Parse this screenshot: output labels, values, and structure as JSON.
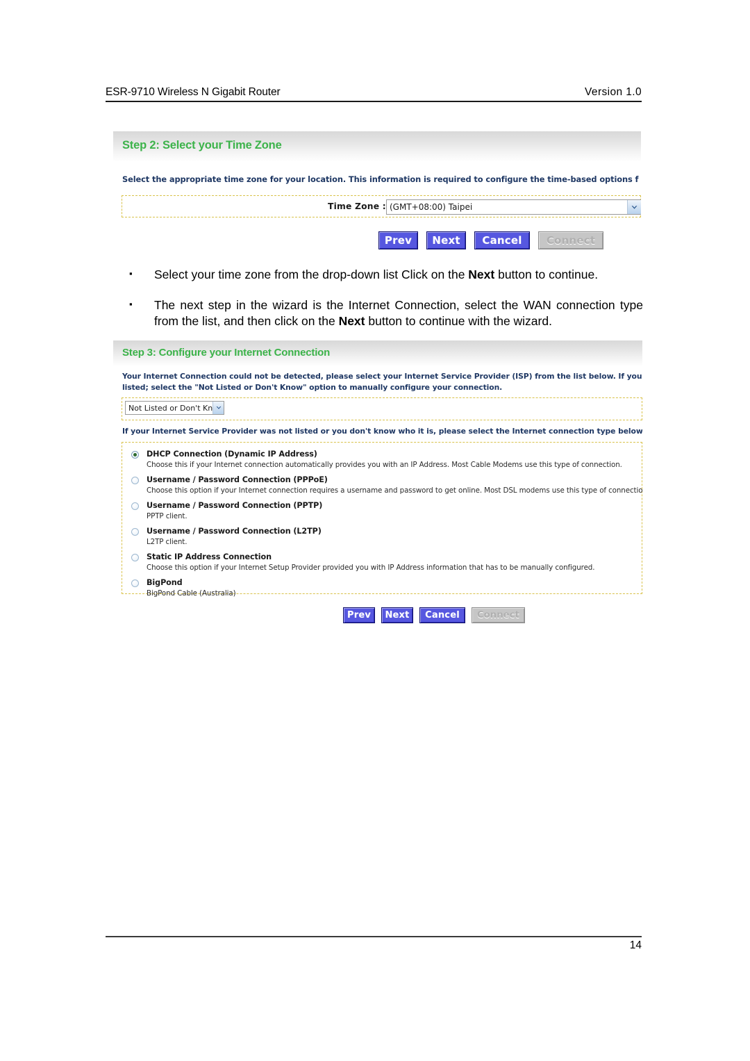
{
  "header": {
    "product": "ESR-9710 Wireless N Gigabit Router",
    "version": "Version 1.0"
  },
  "step2": {
    "title": "Step 2: Select your Time Zone",
    "description": "Select the appropriate time zone for your location. This information is required to configure the time-based options f",
    "timezone_label": "Time Zone :",
    "timezone_value": "(GMT+08:00) Taipei",
    "buttons": {
      "prev": "Prev",
      "next": "Next",
      "cancel": "Cancel",
      "connect": "Connect"
    }
  },
  "bullets": [
    {
      "pre": "Select your time zone from the drop-down list Click on the ",
      "bold": "Next",
      "post": " button to continue."
    },
    {
      "pre": "The next step in the wizard is the Internet Connection, select the WAN connection type from the list, and then click on the ",
      "bold": "Next",
      "post": " button to continue with the wizard."
    }
  ],
  "step3": {
    "title": "Step 3: Configure your Internet Connection",
    "description_line1": "Your Internet Connection could not be detected, please select your Internet Service Provider (ISP) from the list below. If your ISP is not",
    "description_line2": "listed; select the \"Not Listed or Don't Know\" option to manually configure your connection.",
    "isp_select_value": "Not Listed or Don't Know",
    "prompt": "If your Internet Service Provider was not listed or you don't know who it is, please select the Internet connection type below:",
    "options": [
      {
        "label": "DHCP Connection (Dynamic IP Address)",
        "desc": "Choose this if your Internet connection automatically provides you with an IP Address. Most Cable Modems use this type of connection.",
        "selected": true
      },
      {
        "label": "Username / Password Connection (PPPoE)",
        "desc": "Choose this option if your Internet connection requires a username and password to get online. Most DSL modems use this type of connection.",
        "selected": false
      },
      {
        "label": "Username / Password Connection (PPTP)",
        "desc": "PPTP client.",
        "selected": false
      },
      {
        "label": "Username / Password Connection (L2TP)",
        "desc": "L2TP client.",
        "selected": false
      },
      {
        "label": "Static IP Address Connection",
        "desc": "Choose this option if your Internet Setup Provider provided you with IP Address information that has to be manually configured.",
        "selected": false
      },
      {
        "label": "BigPond",
        "desc": "BigPond Cable (Australia)",
        "selected": false
      }
    ],
    "buttons": {
      "prev": "Prev",
      "next": "Next",
      "cancel": "Cancel",
      "connect": "Connect"
    }
  },
  "footer": {
    "page_number": "14"
  },
  "colors": {
    "title_green": "#3cb34a",
    "desc_blue": "#1f3864",
    "button_blue": "#5657e0",
    "dashed_gold": "#d9c24a"
  }
}
